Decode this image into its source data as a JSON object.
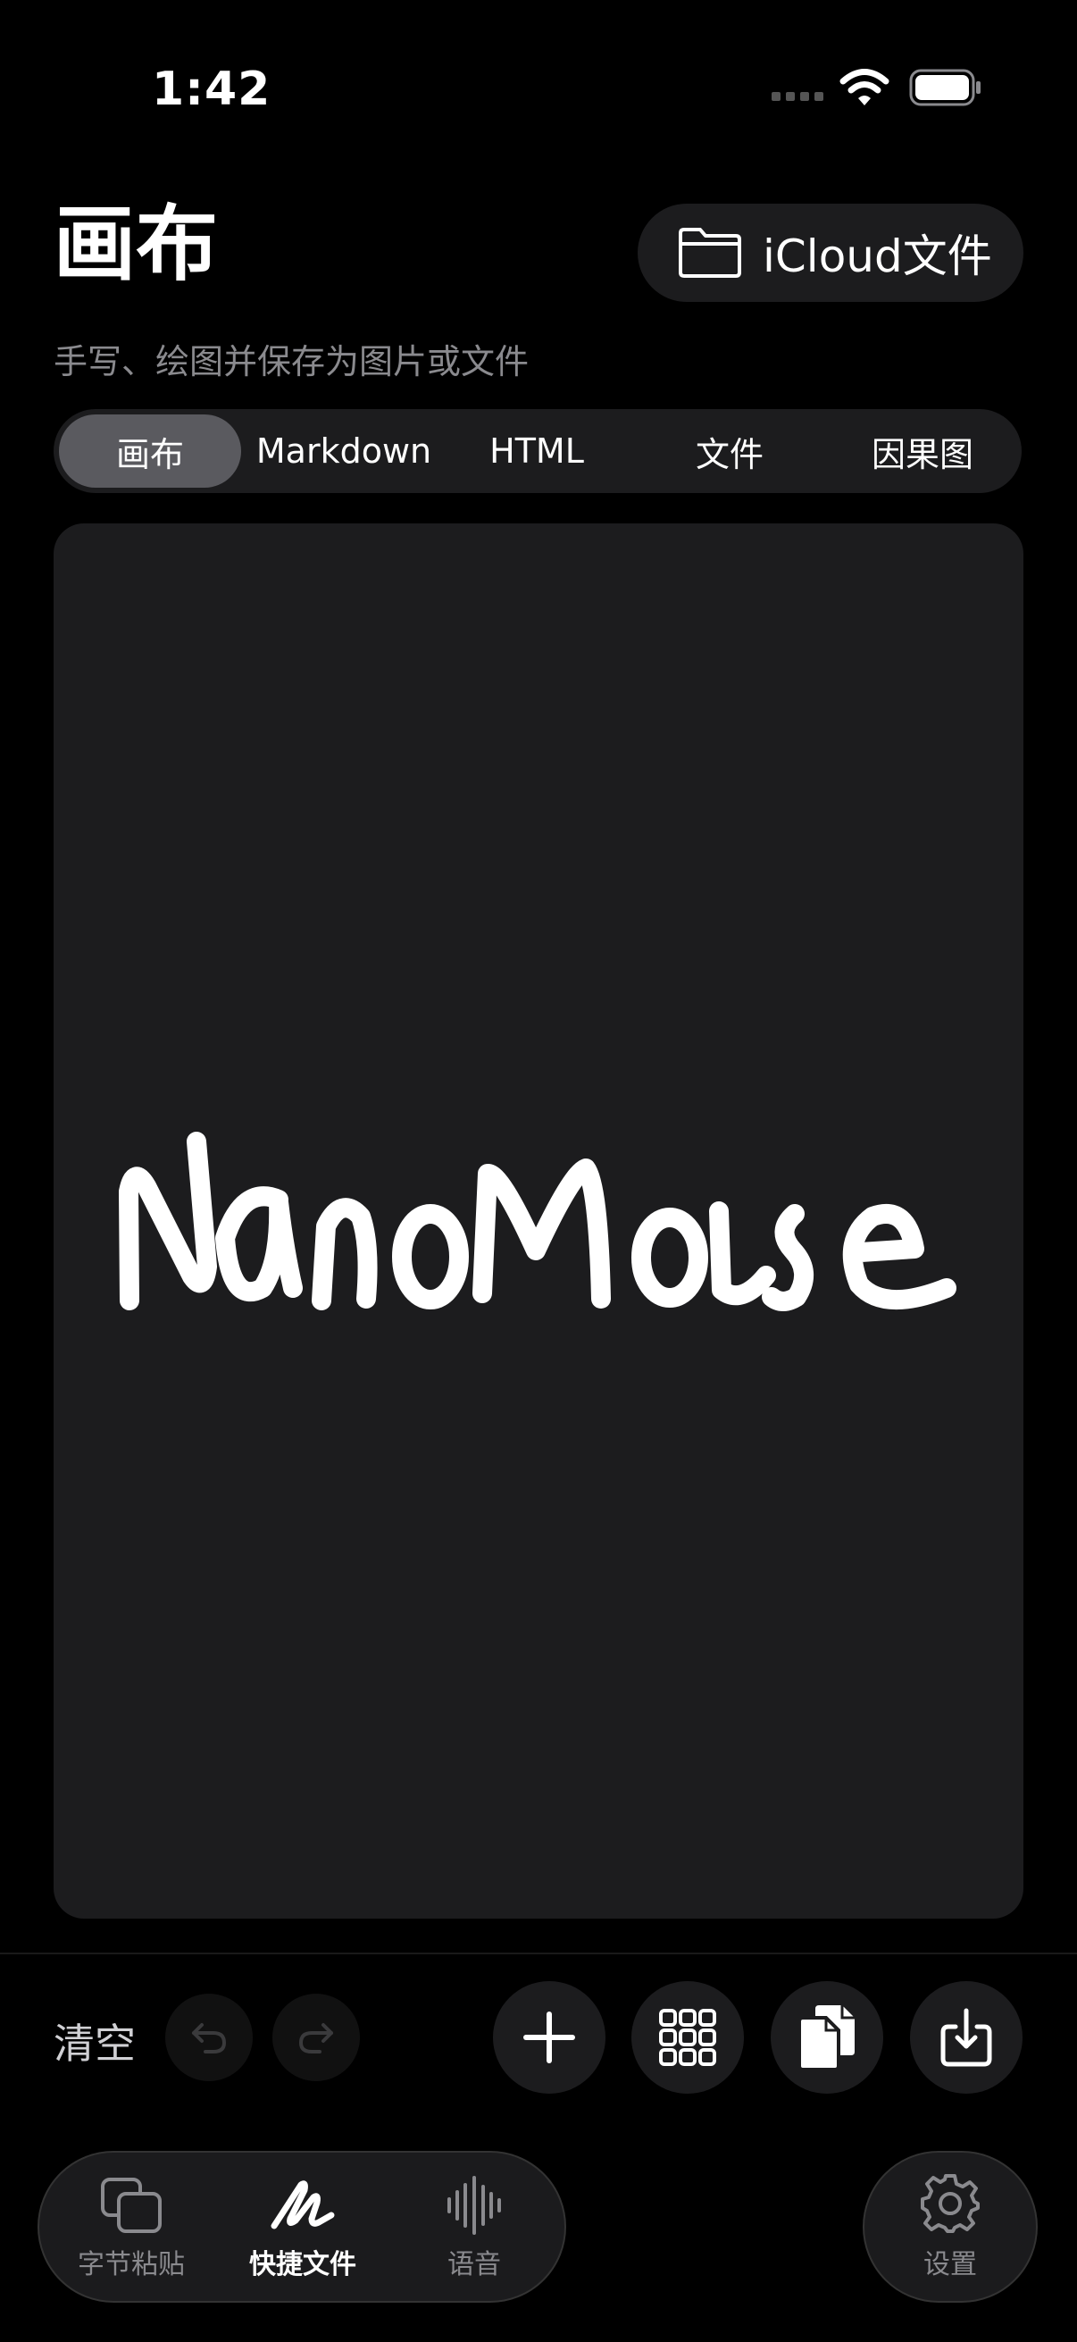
{
  "status_bar": {
    "time": "1:42"
  },
  "header": {
    "title": "画布",
    "subtitle": "手写、绘图并保存为图片或文件",
    "icloud_label": "iCloud文件"
  },
  "segments": {
    "items": [
      "画布",
      "Markdown",
      "HTML",
      "文件",
      "因果图"
    ],
    "selected": "画布"
  },
  "canvas": {
    "handwriting": "NanoMouse"
  },
  "toolbar": {
    "clear_label": "清空",
    "icons": [
      "undo-icon",
      "redo-icon",
      "plus-icon",
      "grid-icon",
      "copy-icon",
      "download-icon"
    ]
  },
  "tabbar": {
    "items": [
      {
        "label": "字节粘贴",
        "icon": "copy-squares-icon"
      },
      {
        "label": "快捷文件",
        "icon": "scribble-icon"
      },
      {
        "label": "语音",
        "icon": "waveform-icon"
      }
    ],
    "active": "快捷文件",
    "settings_label": "设置"
  },
  "colors": {
    "background": "#000000",
    "surface": "#1c1c1e",
    "selected_segment": "#5a5a5f",
    "secondary_text": "#8a8a8e"
  }
}
